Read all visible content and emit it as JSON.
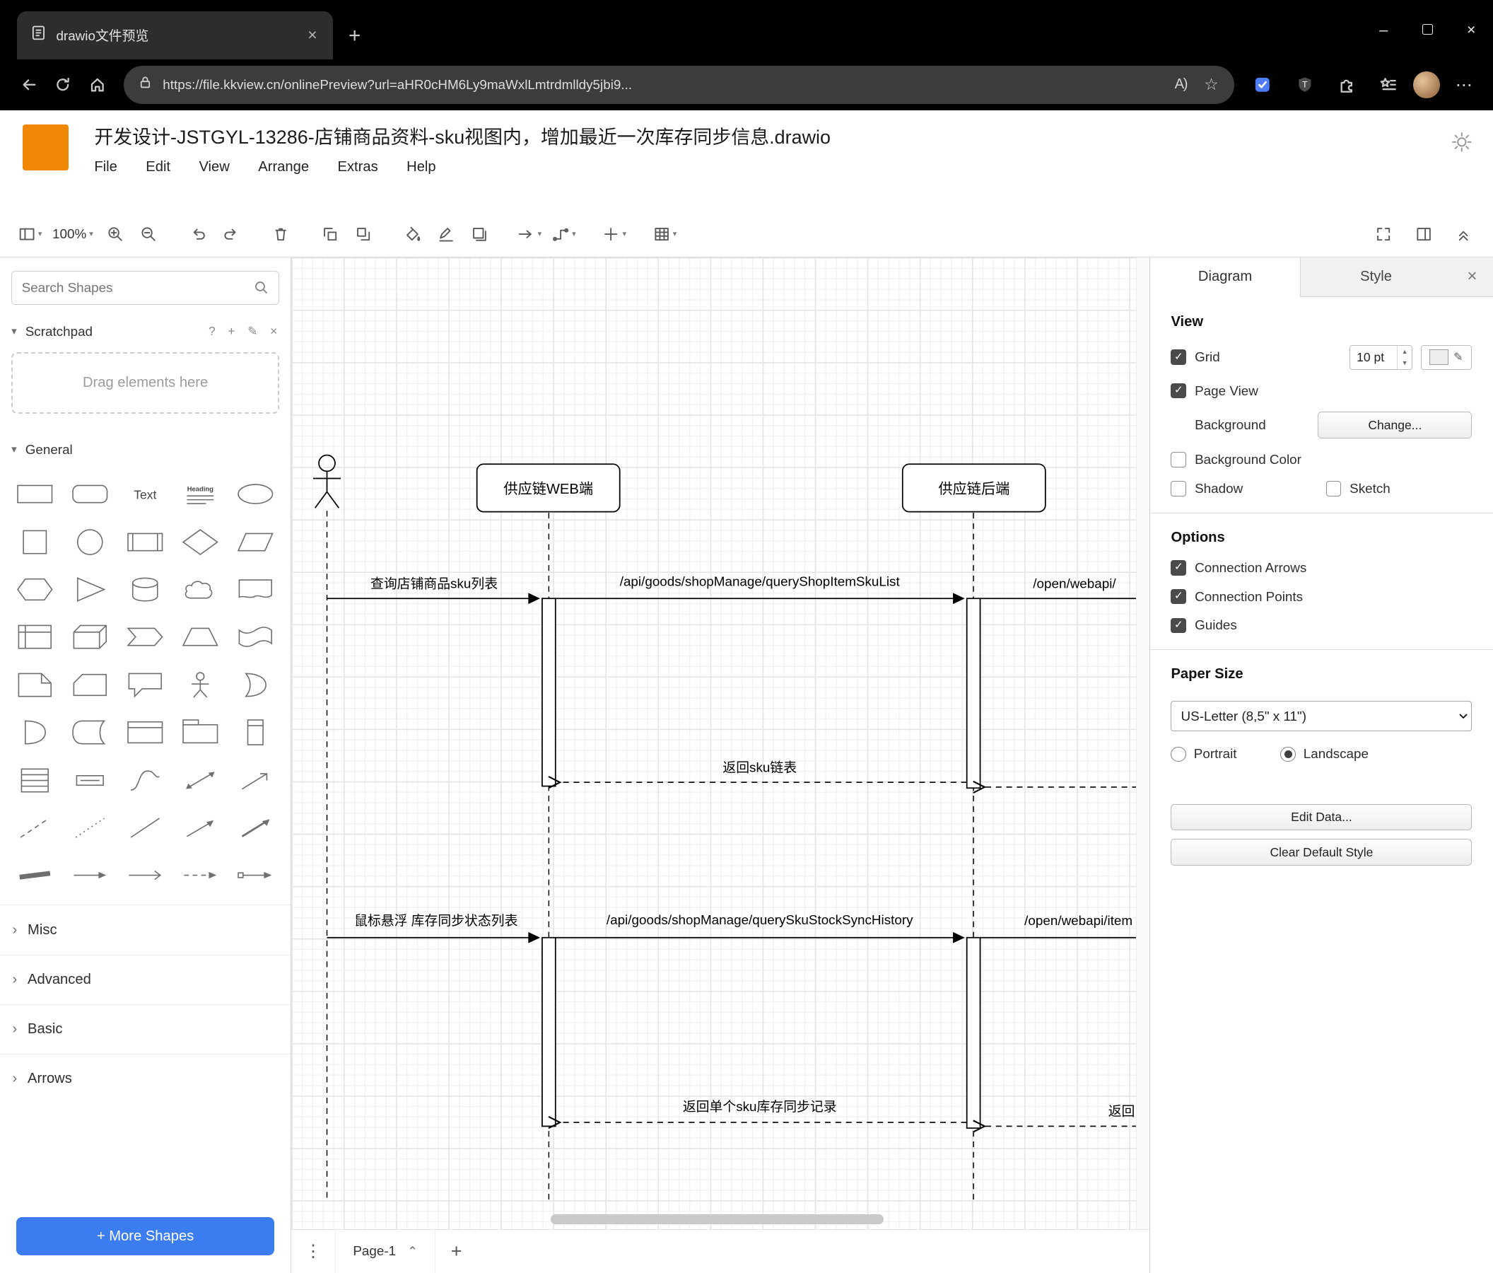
{
  "colors": {
    "accent_blue": "#3b7df0",
    "logo_orange": "#f08705",
    "checked_dark": "#4a4a4a"
  },
  "glyphs": {
    "close": "×",
    "plus": "+",
    "dots_v": "⋮",
    "dots_h": "⋯",
    "chevron_up": "⌃",
    "chevron_down": "▾",
    "chevron_right": "›",
    "question": "?",
    "pencil": "✎",
    "minus": "–",
    "star": "☆",
    "read_aloud": "A)",
    "caret": "▾",
    "spin_up": "▲",
    "spin_down": "▼",
    "ext_t": "T"
  },
  "browser": {
    "tab_title": "drawio文件预览",
    "url": "https://file.kkview.cn/onlinePreview?url=aHR0cHM6Ly9maWxlLmtrdmlldy5jbi9..."
  },
  "app": {
    "title": "开发设计-JSTGYL-13286-店铺商品资料-sku视图内，增加最近一次库存同步信息.drawio",
    "menus": [
      "File",
      "Edit",
      "View",
      "Arrange",
      "Extras",
      "Help"
    ],
    "zoom": "100%"
  },
  "sidebar": {
    "search_placeholder": "Search Shapes",
    "scratchpad": {
      "title": "Scratchpad",
      "drop_hint": "Drag elements here"
    },
    "sections": [
      {
        "label": "General",
        "expanded": true
      },
      {
        "label": "Misc",
        "expanded": false
      },
      {
        "label": "Advanced",
        "expanded": false
      },
      {
        "label": "Basic",
        "expanded": false
      },
      {
        "label": "Arrows",
        "expanded": false
      }
    ],
    "more_shapes": "+ More Shapes",
    "shape_labels": {
      "text": "Text",
      "heading": "Heading"
    },
    "shapes": [
      "rect",
      "rounded",
      "text",
      "heading",
      "ellipse",
      "square",
      "circle",
      "process",
      "diamond",
      "parallelogram",
      "hexagon",
      "triangle",
      "cylinder",
      "cloud",
      "document",
      "internal_storage",
      "cube",
      "step",
      "trapezoid",
      "tape",
      "note",
      "card",
      "callout",
      "actor",
      "or",
      "and",
      "data_storage",
      "container",
      "container_title",
      "vertical_container",
      "list",
      "list_item",
      "curve",
      "bidir_arrow",
      "arrow_ne_open",
      "dashed_line",
      "dotted_line",
      "line",
      "arrow_ne",
      "arrow_ne2",
      "link",
      "arrow_h",
      "arrow_h_open",
      "arrow_h_dashed",
      "arrow_h_box"
    ]
  },
  "diagram": {
    "lifelines": {
      "web": "供应链WEB端",
      "backend": "供应链后端"
    },
    "messages": {
      "m1": "查询店铺商品sku列表",
      "m2": "/api/goods/shopManage/queryShopItemSkuList",
      "m3": "/open/webapi/",
      "r1": "返回sku链表",
      "m4": "鼠标悬浮 库存同步状态列表",
      "m5": "/api/goods/shopManage/querySkuStockSyncHistory",
      "m6": "/open/webapi/item",
      "r2": "返回单个sku库存同步记录",
      "r3": "返回"
    }
  },
  "footer": {
    "page_tab": "Page-1"
  },
  "panel": {
    "tabs": [
      "Diagram",
      "Style"
    ],
    "view": {
      "heading": "View",
      "grid": {
        "label": "Grid",
        "checked": true,
        "size": "10 pt"
      },
      "page_view": {
        "label": "Page View",
        "checked": true
      },
      "background": {
        "label": "Background",
        "button": "Change..."
      },
      "background_color": {
        "label": "Background Color",
        "checked": false
      },
      "shadow": {
        "label": "Shadow",
        "checked": false
      },
      "sketch": {
        "label": "Sketch",
        "checked": false
      }
    },
    "options": {
      "heading": "Options",
      "items": [
        {
          "label": "Connection Arrows",
          "checked": true
        },
        {
          "label": "Connection Points",
          "checked": true
        },
        {
          "label": "Guides",
          "checked": true
        }
      ]
    },
    "paper": {
      "heading": "Paper Size",
      "size": "US-Letter (8,5\" x 11\")",
      "portrait": {
        "label": "Portrait",
        "selected": false
      },
      "landscape": {
        "label": "Landscape",
        "selected": true
      }
    },
    "buttons": {
      "edit_data": "Edit Data...",
      "clear_default": "Clear Default Style"
    }
  }
}
